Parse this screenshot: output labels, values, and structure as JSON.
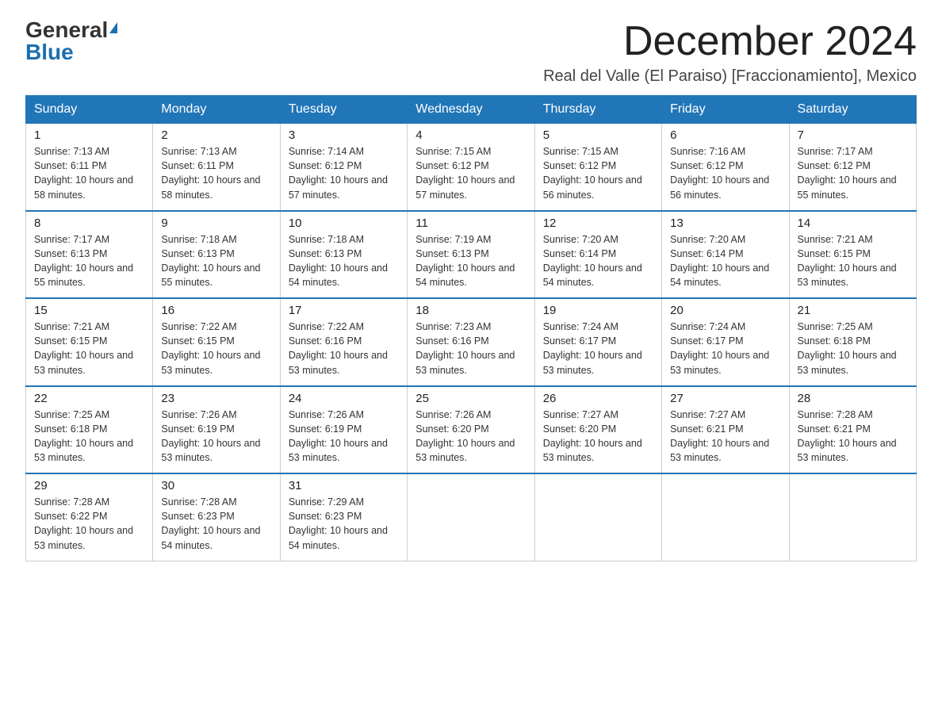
{
  "header": {
    "logo_general": "General",
    "logo_blue": "Blue",
    "month_title": "December 2024",
    "location": "Real del Valle (El Paraiso) [Fraccionamiento], Mexico"
  },
  "weekdays": [
    "Sunday",
    "Monday",
    "Tuesday",
    "Wednesday",
    "Thursday",
    "Friday",
    "Saturday"
  ],
  "weeks": [
    [
      {
        "day": "1",
        "sunrise": "7:13 AM",
        "sunset": "6:11 PM",
        "daylight": "10 hours and 58 minutes."
      },
      {
        "day": "2",
        "sunrise": "7:13 AM",
        "sunset": "6:11 PM",
        "daylight": "10 hours and 58 minutes."
      },
      {
        "day": "3",
        "sunrise": "7:14 AM",
        "sunset": "6:12 PM",
        "daylight": "10 hours and 57 minutes."
      },
      {
        "day": "4",
        "sunrise": "7:15 AM",
        "sunset": "6:12 PM",
        "daylight": "10 hours and 57 minutes."
      },
      {
        "day": "5",
        "sunrise": "7:15 AM",
        "sunset": "6:12 PM",
        "daylight": "10 hours and 56 minutes."
      },
      {
        "day": "6",
        "sunrise": "7:16 AM",
        "sunset": "6:12 PM",
        "daylight": "10 hours and 56 minutes."
      },
      {
        "day": "7",
        "sunrise": "7:17 AM",
        "sunset": "6:12 PM",
        "daylight": "10 hours and 55 minutes."
      }
    ],
    [
      {
        "day": "8",
        "sunrise": "7:17 AM",
        "sunset": "6:13 PM",
        "daylight": "10 hours and 55 minutes."
      },
      {
        "day": "9",
        "sunrise": "7:18 AM",
        "sunset": "6:13 PM",
        "daylight": "10 hours and 55 minutes."
      },
      {
        "day": "10",
        "sunrise": "7:18 AM",
        "sunset": "6:13 PM",
        "daylight": "10 hours and 54 minutes."
      },
      {
        "day": "11",
        "sunrise": "7:19 AM",
        "sunset": "6:13 PM",
        "daylight": "10 hours and 54 minutes."
      },
      {
        "day": "12",
        "sunrise": "7:20 AM",
        "sunset": "6:14 PM",
        "daylight": "10 hours and 54 minutes."
      },
      {
        "day": "13",
        "sunrise": "7:20 AM",
        "sunset": "6:14 PM",
        "daylight": "10 hours and 54 minutes."
      },
      {
        "day": "14",
        "sunrise": "7:21 AM",
        "sunset": "6:15 PM",
        "daylight": "10 hours and 53 minutes."
      }
    ],
    [
      {
        "day": "15",
        "sunrise": "7:21 AM",
        "sunset": "6:15 PM",
        "daylight": "10 hours and 53 minutes."
      },
      {
        "day": "16",
        "sunrise": "7:22 AM",
        "sunset": "6:15 PM",
        "daylight": "10 hours and 53 minutes."
      },
      {
        "day": "17",
        "sunrise": "7:22 AM",
        "sunset": "6:16 PM",
        "daylight": "10 hours and 53 minutes."
      },
      {
        "day": "18",
        "sunrise": "7:23 AM",
        "sunset": "6:16 PM",
        "daylight": "10 hours and 53 minutes."
      },
      {
        "day": "19",
        "sunrise": "7:24 AM",
        "sunset": "6:17 PM",
        "daylight": "10 hours and 53 minutes."
      },
      {
        "day": "20",
        "sunrise": "7:24 AM",
        "sunset": "6:17 PM",
        "daylight": "10 hours and 53 minutes."
      },
      {
        "day": "21",
        "sunrise": "7:25 AM",
        "sunset": "6:18 PM",
        "daylight": "10 hours and 53 minutes."
      }
    ],
    [
      {
        "day": "22",
        "sunrise": "7:25 AM",
        "sunset": "6:18 PM",
        "daylight": "10 hours and 53 minutes."
      },
      {
        "day": "23",
        "sunrise": "7:26 AM",
        "sunset": "6:19 PM",
        "daylight": "10 hours and 53 minutes."
      },
      {
        "day": "24",
        "sunrise": "7:26 AM",
        "sunset": "6:19 PM",
        "daylight": "10 hours and 53 minutes."
      },
      {
        "day": "25",
        "sunrise": "7:26 AM",
        "sunset": "6:20 PM",
        "daylight": "10 hours and 53 minutes."
      },
      {
        "day": "26",
        "sunrise": "7:27 AM",
        "sunset": "6:20 PM",
        "daylight": "10 hours and 53 minutes."
      },
      {
        "day": "27",
        "sunrise": "7:27 AM",
        "sunset": "6:21 PM",
        "daylight": "10 hours and 53 minutes."
      },
      {
        "day": "28",
        "sunrise": "7:28 AM",
        "sunset": "6:21 PM",
        "daylight": "10 hours and 53 minutes."
      }
    ],
    [
      {
        "day": "29",
        "sunrise": "7:28 AM",
        "sunset": "6:22 PM",
        "daylight": "10 hours and 53 minutes."
      },
      {
        "day": "30",
        "sunrise": "7:28 AM",
        "sunset": "6:23 PM",
        "daylight": "10 hours and 54 minutes."
      },
      {
        "day": "31",
        "sunrise": "7:29 AM",
        "sunset": "6:23 PM",
        "daylight": "10 hours and 54 minutes."
      },
      null,
      null,
      null,
      null
    ]
  ],
  "labels": {
    "sunrise_prefix": "Sunrise: ",
    "sunset_prefix": "Sunset: ",
    "daylight_prefix": "Daylight: "
  }
}
